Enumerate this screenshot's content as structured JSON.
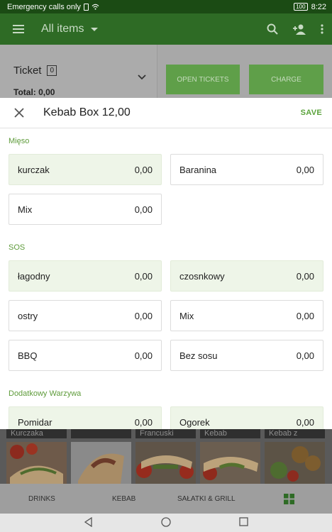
{
  "status_bar": {
    "left_text": "Emergency calls only",
    "battery": "100",
    "time": "8:22"
  },
  "app_bar": {
    "title": "All items",
    "menu_icon": "hamburger-icon",
    "search_icon": "search-icon",
    "add_person_icon": "add-person-icon",
    "more_icon": "more-vert-icon"
  },
  "ticket": {
    "title": "Ticket",
    "count": "0",
    "total_label": "Total:",
    "total_value": "0,00"
  },
  "buttons": {
    "open_tickets": "OPEN TICKETS",
    "charge": "CHARGE"
  },
  "modal": {
    "title": "Kebab Box 12,00",
    "save_label": "SAVE",
    "close_icon": "close-icon",
    "sections": [
      {
        "title": "Mięso",
        "options": [
          {
            "name": "kurczak",
            "price": "0,00",
            "selected": true
          },
          {
            "name": "Baranina",
            "price": "0,00",
            "selected": false
          },
          {
            "name": "Mix",
            "price": "0,00",
            "selected": false
          }
        ]
      },
      {
        "title": "SOS",
        "options": [
          {
            "name": "łagodny",
            "price": "0,00",
            "selected": true
          },
          {
            "name": "czosnkowy",
            "price": "0,00",
            "selected": true
          },
          {
            "name": "ostry",
            "price": "0,00",
            "selected": false
          },
          {
            "name": "Mix",
            "price": "0,00",
            "selected": false
          },
          {
            "name": "BBQ",
            "price": "0,00",
            "selected": false
          },
          {
            "name": "Bez sosu",
            "price": "0,00",
            "selected": false
          }
        ]
      },
      {
        "title": "Dodatkowy Warzywa",
        "options": [
          {
            "name": "Pomidar",
            "price": "0,00",
            "selected": true
          },
          {
            "name": "Ogorek",
            "price": "0,00",
            "selected": true
          }
        ]
      }
    ]
  },
  "items": [
    {
      "label": "Kurczaka"
    },
    {
      "label": ""
    },
    {
      "label": "Francuski"
    },
    {
      "label": "Kebab"
    },
    {
      "label": "Kebab z"
    }
  ],
  "categories": [
    "DRINKS",
    "KEBAB",
    "SAŁATKI & GRILL"
  ],
  "colors": {
    "accent": "#5aa33b",
    "appbar": "#2e6b25",
    "statusbar": "#1b4b14",
    "selected_option": "#eef5e8"
  }
}
